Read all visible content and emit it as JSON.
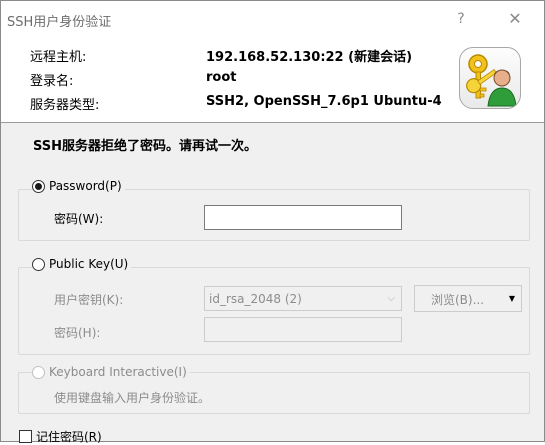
{
  "window": {
    "title": "SSH用户身份验证",
    "help": "?",
    "close": "✕"
  },
  "info": {
    "host_label": "远程主机:",
    "host_value": "192.168.52.130:22 (新建会话)",
    "login_label": "登录名:",
    "login_value": "root",
    "server_label": "服务器类型:",
    "server_value": "SSH2, OpenSSH_7.6p1 Ubuntu-4"
  },
  "icons": {
    "dialog": "keys-user-icon"
  },
  "message": "SSH服务器拒绝了密码。请再试一次。",
  "password_group": {
    "option_label": "Password(P)",
    "selected": true,
    "password_label": "密码(W):",
    "password_value": ""
  },
  "publickey_group": {
    "option_label": "Public Key(U)",
    "selected": false,
    "userkey_label": "用户密钥(K):",
    "userkey_value": "id_rsa_2048 (2)",
    "browse_label": "浏览(B)...",
    "passphrase_label": "密码(H):"
  },
  "keyboard_group": {
    "option_label": "Keyboard Interactive(I)",
    "description": "使用键盘输入用户身份验证。"
  },
  "remember": {
    "label": "记住密码(R)",
    "checked": false
  },
  "colors": {
    "window_bg": "#f0f0f0",
    "panel_bg": "#ffffff",
    "disabled_text": "#8c8c8c"
  }
}
